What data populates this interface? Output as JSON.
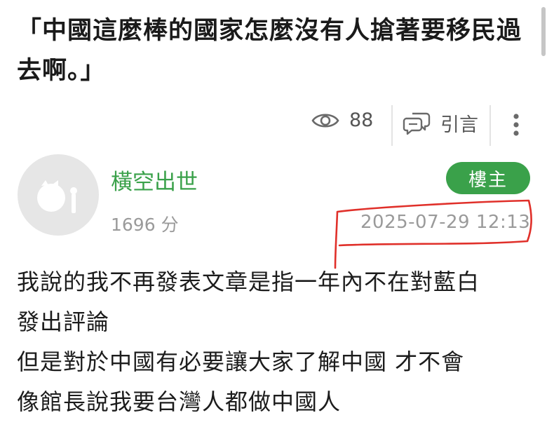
{
  "post": {
    "title": "「中國這麼棒的國家怎麼沒有人搶著要移民過去啊。」",
    "views": "88",
    "quote_label": "引言",
    "author": {
      "name": "橫空出世",
      "score": "1696 分",
      "badge": "樓主"
    },
    "timestamp": "2025-07-29 12:13",
    "body_lines": [
      "我說的我不再發表文章是指一年內不在對藍白",
      "發出評論",
      "但是對於中國有必要讓大家了解中國 才不會",
      "像館長說我要台灣人都做中國人"
    ]
  },
  "colors": {
    "accent_green": "#3aa14a",
    "muted_text": "#9a9a9a",
    "annotation_red": "#e0302a"
  },
  "icons": [
    "eye-icon",
    "quote-chat-icon",
    "more-vertical-icon",
    "default-avatar-icon"
  ]
}
